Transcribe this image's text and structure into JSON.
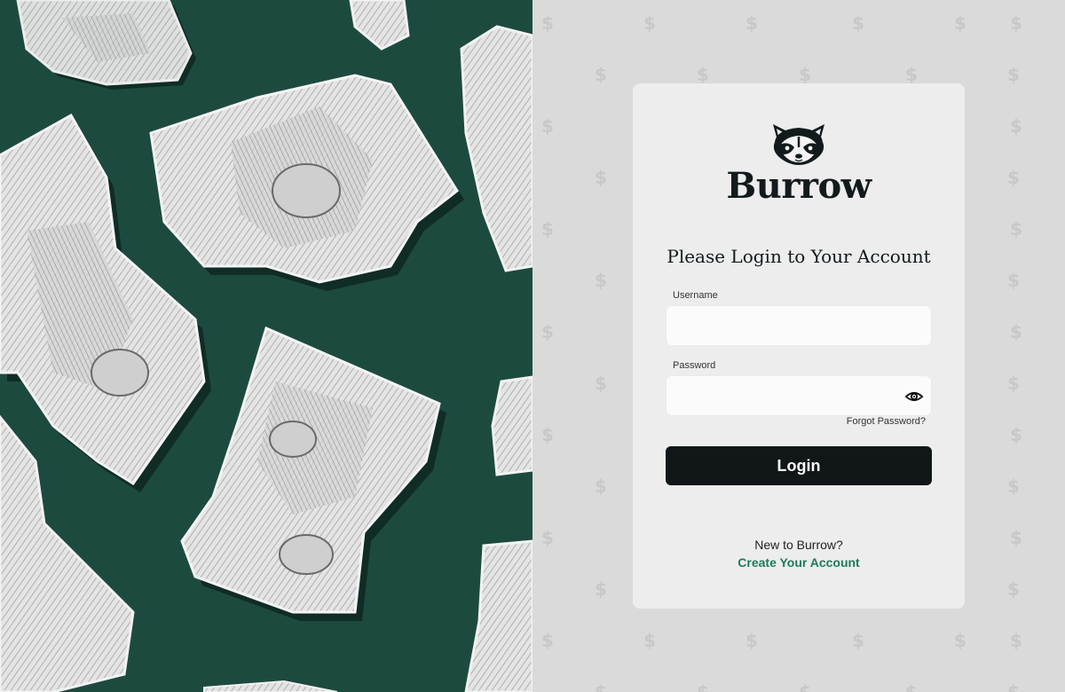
{
  "brand": {
    "name": "Burrow",
    "logo_icon": "raccoon-icon"
  },
  "login": {
    "heading": "Please Login to Your Account",
    "username_label": "Username",
    "username_value": "",
    "password_label": "Password",
    "password_value": "",
    "show_password_icon": "eye-icon",
    "forgot_password": "Forgot Password?",
    "submit_label": "Login"
  },
  "signup": {
    "prompt": "New to Burrow?",
    "link_label": "Create Your Account"
  },
  "background": {
    "pattern_glyph": "$",
    "left_panel_image": "crumpled dollar bills"
  },
  "colors": {
    "left_panel": "#1d4a3f",
    "right_panel": "#dadada",
    "card": "#ededed",
    "button": "#111719",
    "link": "#1f7a5c"
  }
}
